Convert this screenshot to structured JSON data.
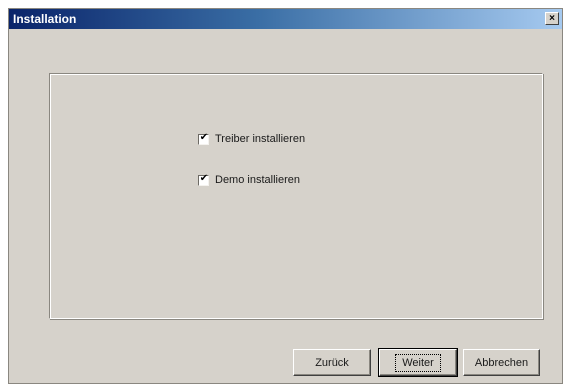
{
  "window": {
    "title": "Installation",
    "close_glyph": "×"
  },
  "options": [
    {
      "label": "Treiber installieren",
      "checked": true,
      "check_glyph": "✔"
    },
    {
      "label": "Demo installieren",
      "checked": true,
      "check_glyph": "✔"
    }
  ],
  "buttons": {
    "back": "Zurück",
    "next": "Weiter",
    "cancel": "Abbrechen"
  },
  "colors": {
    "titlebar_start": "#0a246a",
    "titlebar_end": "#a6caf0",
    "dialog_bg": "#d6d2cb"
  }
}
